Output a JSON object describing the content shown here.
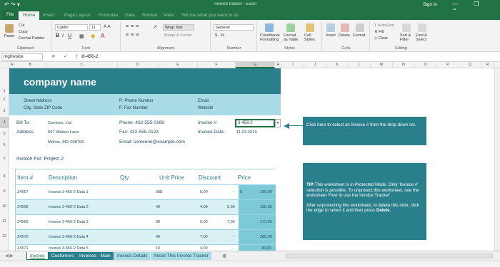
{
  "titlebar": {
    "quick_access": "↶ ↷ ▾",
    "document": "Invoice tracker - Excel",
    "signin": "Sign in",
    "window_buttons": "— ❐ ✕"
  },
  "tabs": [
    "File",
    "Home",
    "Insert",
    "Page Layout",
    "Formulas",
    "Data",
    "Review",
    "View",
    "Tell me what you want to do"
  ],
  "ribbon": {
    "clipboard": {
      "paste": "Paste",
      "cut": "Cut",
      "copy": "Copy",
      "format_painter": "Format Painter",
      "label": "Clipboard"
    },
    "font": {
      "name": "Calibri",
      "size": "11",
      "bold": "B",
      "italic": "I",
      "underline": "U",
      "label": "Font"
    },
    "alignment": {
      "wrap_text": "Wrap Text",
      "merge_center": "Merge & Center",
      "label": "Alignment"
    },
    "number": {
      "format": "General",
      "currency": "$ - % ,",
      "label": "Number"
    },
    "styles": {
      "conditional": "Conditional Formatting",
      "format_table": "Format as Table",
      "cell_styles": "Cell Styles",
      "label": "Styles"
    },
    "cells": {
      "insert": "Insert",
      "delete": "Delete",
      "format": "Format",
      "label": "Cells"
    },
    "editing": {
      "autosum": "AutoSum",
      "fill": "Fill",
      "clear": "Clear",
      "sort": "Sort & Filter",
      "find": "Find & Select",
      "label": "Editing"
    }
  },
  "formula_bar": {
    "name_box": "rngInvoice",
    "fx": "✕ ✓ fx",
    "value": "3-456-2"
  },
  "columns": [
    "A",
    "B",
    "C",
    "D",
    "E",
    "F",
    "G",
    "H",
    "I",
    "J",
    "K",
    "L",
    "M",
    "N",
    "O",
    "P",
    "Q",
    "R"
  ],
  "rows": [
    "1",
    "2",
    "3",
    "4",
    "5",
    "6",
    "7",
    "8",
    "9",
    "10",
    "11",
    "12"
  ],
  "sheet": {
    "company_name": "company name",
    "street": "Street Address",
    "city": "City, State ZIP Code",
    "phone": "P: Phone Number",
    "fax": "F: Fax Number",
    "email": "Email",
    "website": "Website",
    "bill_to_label": "Bill To:",
    "bill_to_value": "Contoso, Ltd",
    "address_label": "Address:",
    "address_line1": "567 Walnut Lane",
    "address_line2": "Moline, MO 098765",
    "phone_line": "Phone: 432-555-0189",
    "fax_line": "Fax:    432-555-0123",
    "email_line": "Email: someone@example.com",
    "invoice_label": "Invoice #:",
    "invoice_value": "3-456-2",
    "date_label": "Invoice Date:",
    "date_value": "11.03.2019",
    "invoice_for": "Invoice For: Project 2"
  },
  "table": {
    "headers": [
      "Item #",
      "Description",
      "Qty",
      "Unit Price",
      "Discount",
      "Price"
    ],
    "rows": [
      {
        "item": "Z4567",
        "desc": "Invoice 3-456-2 Data 1",
        "qty": "39",
        "cur": "$",
        "unit": "5,00",
        "disc_cur": "$",
        "disc": "-",
        "price_cur": "$",
        "price": "195,00"
      },
      {
        "item": "Z4568",
        "desc": "Invoice 3-456-2 Data 2",
        "qty": "40",
        "cur": "",
        "unit": "4,00",
        "disc_cur": "",
        "disc": "5,00",
        "price_cur": "",
        "price": "155,00"
      },
      {
        "item": "Z4569",
        "desc": "Invoice 3-456-2 Data 3",
        "qty": "30",
        "cur": "",
        "unit": "6,00",
        "disc_cur": "",
        "disc": "7,00",
        "price_cur": "",
        "price": "173,00"
      },
      {
        "item": "Z4570",
        "desc": "Invoice 3-456-2 Data 4",
        "qty": "40",
        "cur": "",
        "unit": "7,00",
        "disc_cur": "",
        "disc": "-",
        "price_cur": "",
        "price": "280,00"
      },
      {
        "item": "Z4571",
        "desc": "Invoice 3-456-2 Data 5",
        "qty": "10",
        "cur": "",
        "unit": "4,00",
        "disc_cur": "",
        "disc": "-",
        "price_cur": "",
        "price": "40,00"
      }
    ]
  },
  "notes": {
    "dropdown_tip": "Click here to select an Invoice # from the drop down list.",
    "tip_title": "TIP:",
    "tip_body": "This worksheet is in Protected Mode. Only 'Invoice #' selection is possible. To unprotect this worksheet, see the worksheet 'How to use the Invoice Tracker'.",
    "tip_body2": "After unprotecting this worksheet, to delete this note, click the edge to select it and then press ",
    "tip_delete": "Delete",
    "tip_end": "."
  },
  "sheet_tabs": [
    "Invoice",
    "Customers",
    "Invoices - Main",
    "Invoice Details",
    "About This Invoice Tracker"
  ],
  "add_sheet": "⊕",
  "colors": {
    "excel_green": "#217346",
    "teal_dark": "#2a7f8d",
    "teal_light": "#a9dbe7",
    "row_alt": "#d9f0f5",
    "price_col": "#7cc9d8"
  }
}
